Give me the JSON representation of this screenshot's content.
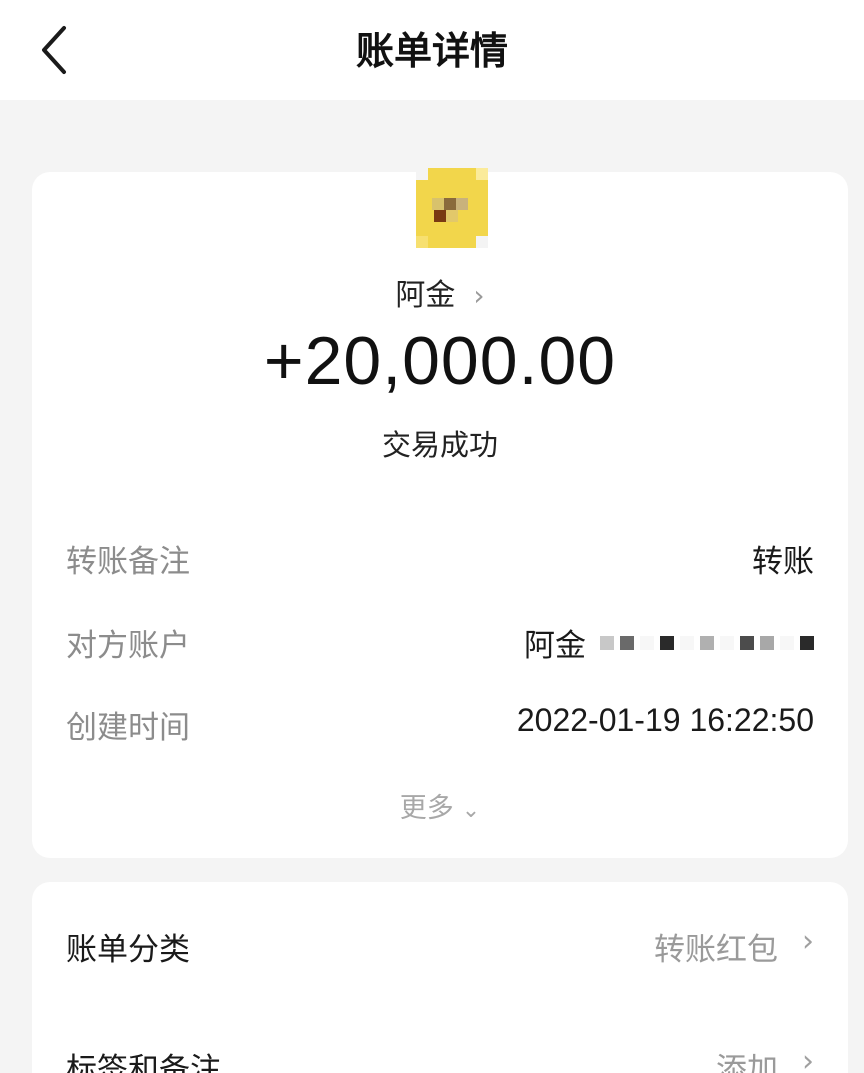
{
  "header": {
    "title": "账单详情",
    "back_icon": "chevron-left-icon"
  },
  "payee": {
    "name": "阿金",
    "chevron": "›"
  },
  "amount": "+20,000.00",
  "status": "交易成功",
  "details": {
    "remark_label": "转账备注",
    "remark_value": "转账",
    "account_label": "对方账户",
    "account_name": "阿金",
    "time_label": "创建时间",
    "time_value": "2022-01-19 16:22:50"
  },
  "more": {
    "label": "更多",
    "chevron": "⌄"
  },
  "list": {
    "category_label": "账单分类",
    "category_value": "转账红包",
    "tags_label": "标签和备注",
    "tags_value": "添加",
    "chevron": "›"
  },
  "colors": {
    "background": "#f4f4f4",
    "card": "#ffffff",
    "avatar": "#f2d64b"
  }
}
